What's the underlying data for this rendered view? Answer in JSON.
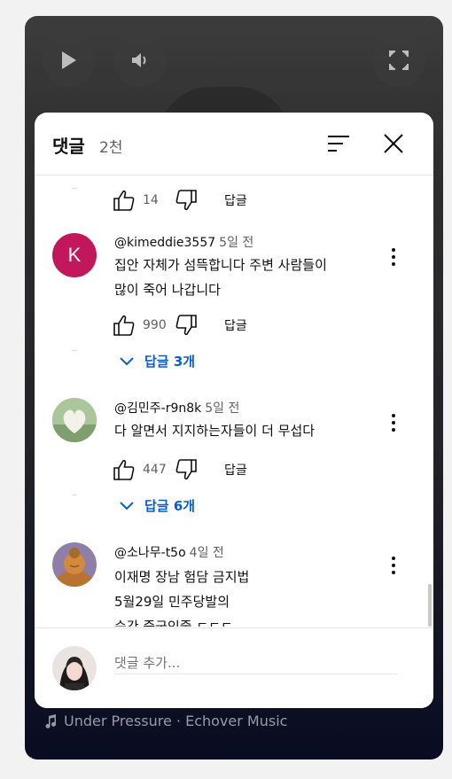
{
  "player": {
    "music_label": "Under Pressure · Echover Music"
  },
  "sheet": {
    "title": "댓글",
    "count": "2천"
  },
  "top_partial": {
    "like_count": "14",
    "reply_label": "답글"
  },
  "comments": [
    {
      "avatar_letter": "K",
      "author": "@kimeddie3557",
      "time": "5일 전",
      "lines": [
        "집안 자체가 섬뜩합니다 주변 사람들이",
        "많이 죽어 나갑니다"
      ],
      "like_count": "990",
      "reply_label": "답글",
      "replies": "답글 3개"
    },
    {
      "author": "@김민주-r9n8k",
      "time": "5일 전",
      "lines": [
        "다 알면서 지지하는자들이 더 무섭다"
      ],
      "like_count": "447",
      "reply_label": "답글",
      "replies": "답글 6개"
    },
    {
      "author": "@소나무-t5o",
      "time": "4일 전",
      "lines": [
        "이재명 장남 험담 금지법",
        "5월29일 민주당발의",
        "순간 중국인줄 ㄷㄷㄷ"
      ]
    }
  ],
  "composer": {
    "placeholder": "댓글 추가..."
  },
  "colors": {
    "accent_link": "#065fd4",
    "avatar_k": "#c2185b"
  }
}
